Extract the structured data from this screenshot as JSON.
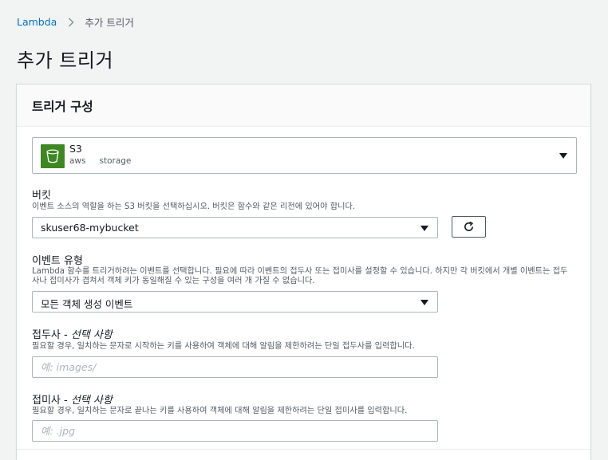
{
  "breadcrumb": {
    "root": "Lambda",
    "current": "추가 트리거"
  },
  "page": {
    "title": "추가 트리거"
  },
  "panel": {
    "title": "트리거 구성",
    "trigger": {
      "name": "S3",
      "tags": [
        "aws",
        "storage"
      ],
      "icon": "s3-bucket-icon",
      "icon_color": "#3f8624"
    },
    "bucket": {
      "label": "버킷",
      "description": "이벤트 소스의 역할을 하는 S3 버킷을 선택하십시오. 버킷은 함수와 같은 리전에 있어야 합니다.",
      "value": "skuser68-mybucket",
      "refresh_icon": "refresh-icon"
    },
    "event_type": {
      "label": "이벤트 유형",
      "description": "Lambda 함수를 트리거하려는 이벤트를 선택합니다. 필요에 따라 이벤트의 접두사 또는 접미사를 설정할 수 있습니다. 하지만 각 버킷에서 개별 이벤트는 접두사나 접미사가 겹쳐서 객체 키가 동일해질 수 있는 구성을 여러 개 가질 수 없습니다.",
      "value": "모든 객체 생성 이벤트"
    },
    "prefix": {
      "label": "접두사 - ",
      "optional": "선택 사항",
      "description": "필요할 경우, 일치하는 문자로 시작하는 키를 사용하여 객체에 대해 알림을 제한하려는 단일 접두사를 입력합니다.",
      "value": "",
      "placeholder": "예: images/"
    },
    "suffix": {
      "label": "접미사 - ",
      "optional": "선택 사항",
      "description": "필요할 경우, 일치하는 문자로 끝나는 키를 사용하여 객체에 대해 알림을 제한하려는 단일 접미사를 입력합니다.",
      "value": "",
      "placeholder": "예: .jpg"
    }
  },
  "colors": {
    "link": "#0073bb",
    "s3_green": "#3f8624",
    "border": "#aab7b8",
    "background": "#f2f3f3"
  }
}
